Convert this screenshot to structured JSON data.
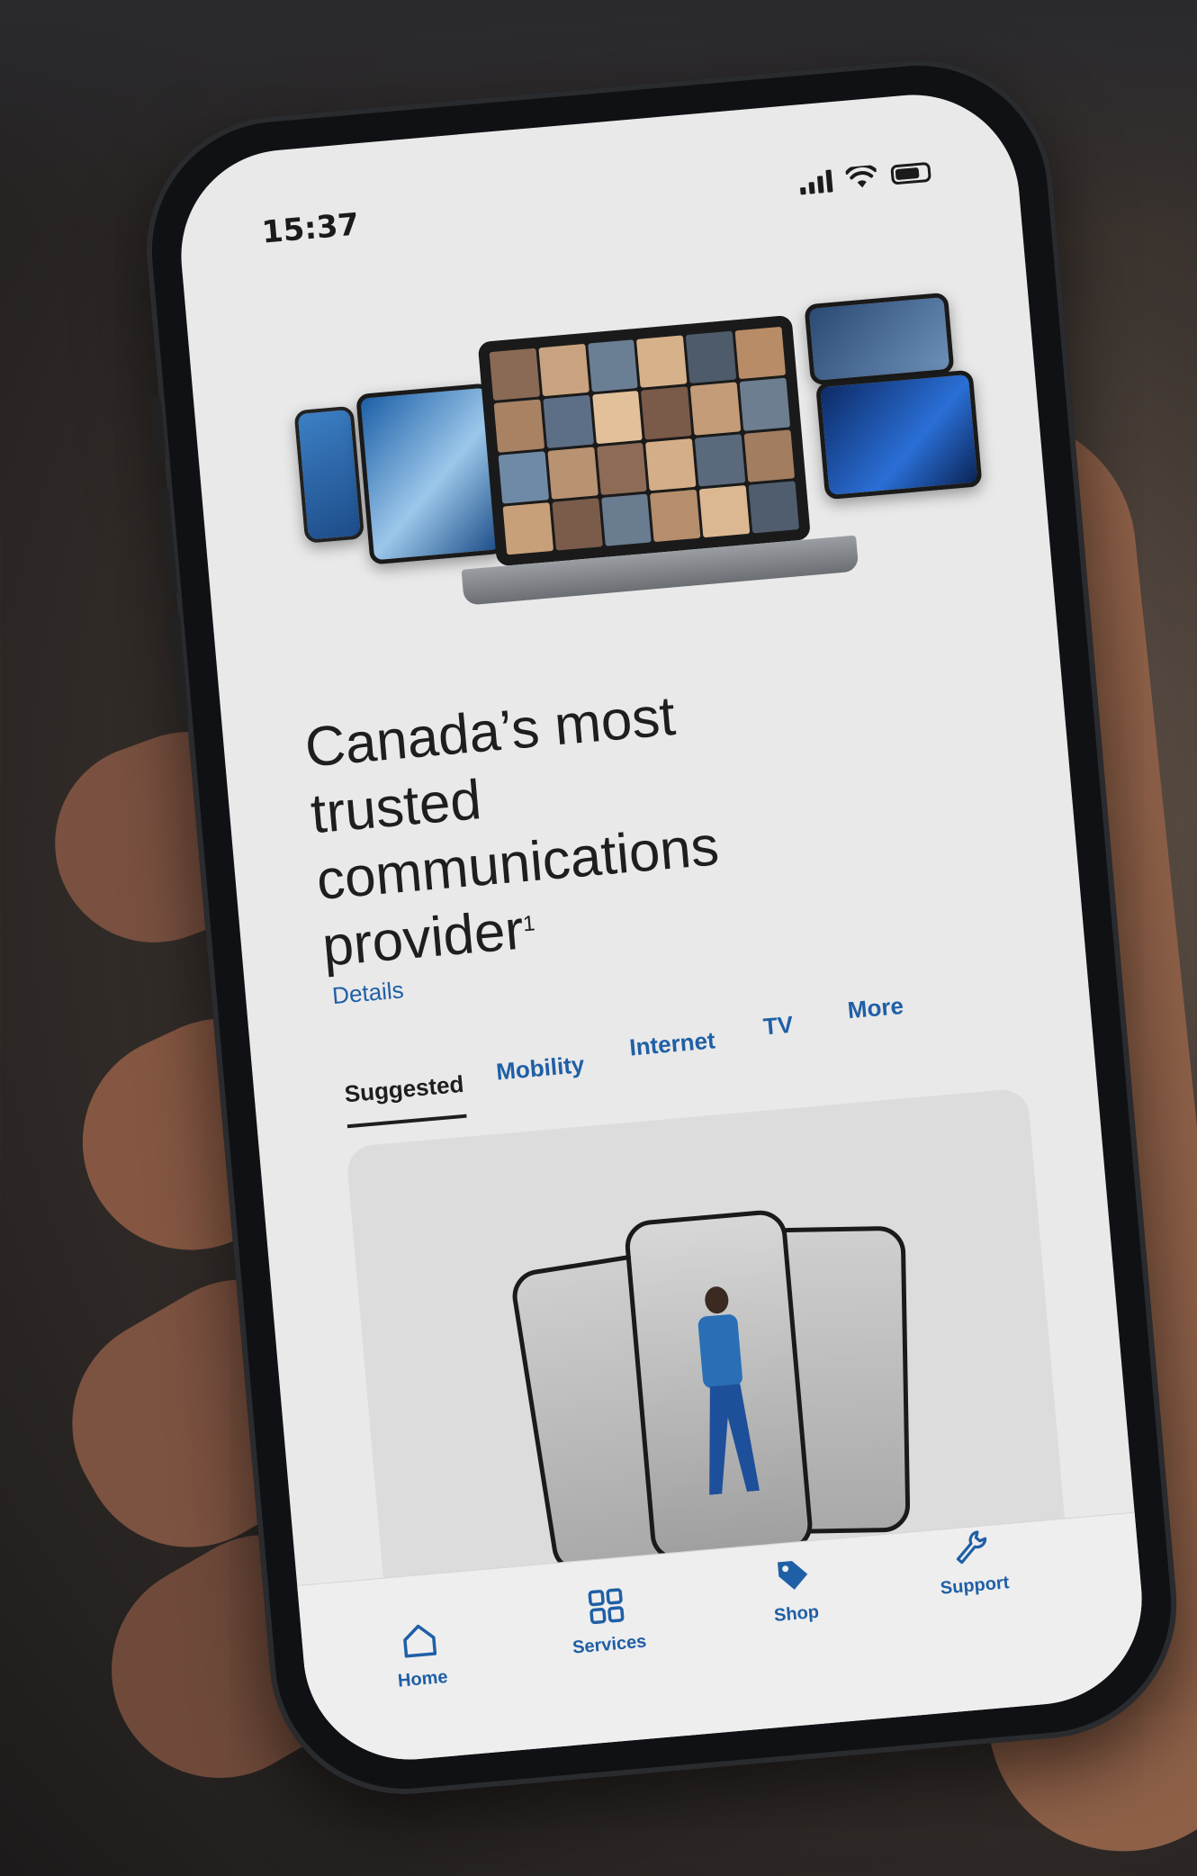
{
  "status_bar": {
    "time": "15:37"
  },
  "hero": {
    "headline_lines": [
      "Canada’s most",
      "trusted",
      "communications",
      "provider"
    ],
    "footnote_mark": "1",
    "details_link": "Details"
  },
  "tabs": [
    {
      "label": "Suggested",
      "active": true
    },
    {
      "label": "Mobility",
      "active": false
    },
    {
      "label": "Internet",
      "active": false
    },
    {
      "label": "TV",
      "active": false
    },
    {
      "label": "More",
      "active": false
    }
  ],
  "bottom_nav": [
    {
      "label": "Home",
      "icon": "home-icon"
    },
    {
      "label": "Services",
      "icon": "grid-icon"
    },
    {
      "label": "Shop",
      "icon": "tag-icon"
    },
    {
      "label": "Support",
      "icon": "wrench-icon"
    }
  ],
  "colors": {
    "accent": "#1f5fa6",
    "text": "#1e1e1e",
    "screen_bg": "#e9e9e9"
  }
}
